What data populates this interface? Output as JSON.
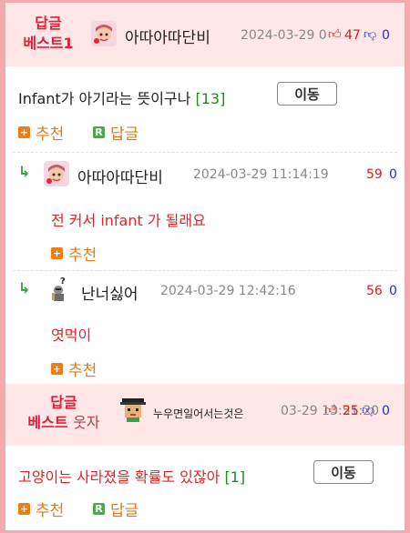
{
  "best1": {
    "badge_line1": "답글",
    "badge_line2": "베스트1",
    "nickname": "아따아따단비",
    "date": "2024-03-29 0",
    "up_count": "47",
    "down_count": "0",
    "avatar_icon": "cartoon-girl-avatar"
  },
  "post": {
    "title": "Infant가 아기라는 뜻이구나",
    "comment_count": "[13]",
    "move_label": "이동",
    "recommend_label": "추천",
    "reply_label": "답글"
  },
  "replies": [
    {
      "nickname": "아따아따단비",
      "date": "2024-03-29 11:14:19",
      "up": "59",
      "down": "0",
      "content": "전 커서 infant 가 될래요",
      "recommend_label": "추천",
      "avatar_icon": "cartoon-girl-avatar"
    },
    {
      "nickname": "난너싫어",
      "date": "2024-03-29 12:42:16",
      "up": "56",
      "down": "0",
      "content": "엿먹이",
      "recommend_label": "추천",
      "avatar_icon": "knight-question-avatar"
    }
  ],
  "best2": {
    "badge_line1": "답글",
    "badge_line2": "베스트",
    "badge_extra": "웃자",
    "nickname": "누우면일어서는것은",
    "date": "03-29 13:51:20",
    "up_count": "25",
    "down_count": "0",
    "avatar_icon": "pixel-man-avatar"
  },
  "post2": {
    "title": "고양이는 사라졌을 확률도 있잖아",
    "comment_count": "[1]",
    "move_label": "이동",
    "recommend_label": "추천",
    "reply_label": "답글"
  },
  "colors": {
    "border": "#f3a9ad",
    "header_bg": "#ffe7e8",
    "accent_red": "#e0203a",
    "action_orange": "#e07b18",
    "count_green": "#1e8b1e"
  }
}
